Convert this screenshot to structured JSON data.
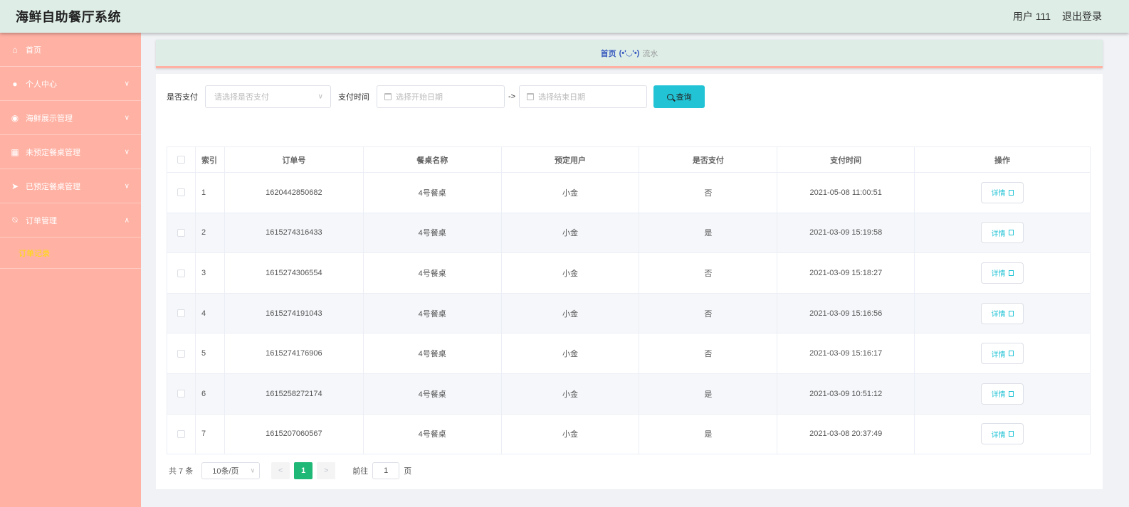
{
  "header": {
    "title": "海鲜自助餐厅系统",
    "user": "用户 111",
    "logout": "退出登录"
  },
  "sidebar": {
    "items": [
      {
        "label": "首页",
        "icon": "home-icon",
        "expandable": false
      },
      {
        "label": "个人中心",
        "icon": "user-icon",
        "expandable": true
      },
      {
        "label": "海鲜展示管理",
        "icon": "pin-icon",
        "expandable": true
      },
      {
        "label": "未预定餐桌管理",
        "icon": "grid-icon",
        "expandable": true
      },
      {
        "label": "已预定餐桌管理",
        "icon": "send-icon",
        "expandable": true
      },
      {
        "label": "订单管理",
        "icon": "bell-off-icon",
        "expandable": true
      }
    ],
    "sub_active": "订单记录"
  },
  "breadcrumb": {
    "home": "首页",
    "face": "(•'◡'•)",
    "current": "流水"
  },
  "filter": {
    "paid_label": "是否支付",
    "paid_placeholder": "请选择是否支付",
    "time_label": "支付时间",
    "start_placeholder": "选择开始日期",
    "separator": "->",
    "end_placeholder": "选择结束日期",
    "query_button": "查询"
  },
  "table": {
    "headers": {
      "index": "索引",
      "order_no": "订单号",
      "table_name": "餐桌名称",
      "user": "预定用户",
      "paid": "是否支付",
      "time": "支付时间",
      "action": "操作"
    },
    "detail_label": "详情",
    "rows": [
      {
        "index": "1",
        "order_no": "1620442850682",
        "table_name": "4号餐桌",
        "user": "小金",
        "paid": "否",
        "time": "2021-05-08 11:00:51"
      },
      {
        "index": "2",
        "order_no": "1615274316433",
        "table_name": "4号餐桌",
        "user": "小金",
        "paid": "是",
        "time": "2021-03-09 15:19:58"
      },
      {
        "index": "3",
        "order_no": "1615274306554",
        "table_name": "4号餐桌",
        "user": "小金",
        "paid": "否",
        "time": "2021-03-09 15:18:27"
      },
      {
        "index": "4",
        "order_no": "1615274191043",
        "table_name": "4号餐桌",
        "user": "小金",
        "paid": "否",
        "time": "2021-03-09 15:16:56"
      },
      {
        "index": "5",
        "order_no": "1615274176906",
        "table_name": "4号餐桌",
        "user": "小金",
        "paid": "否",
        "time": "2021-03-09 15:16:17"
      },
      {
        "index": "6",
        "order_no": "1615258272174",
        "table_name": "4号餐桌",
        "user": "小金",
        "paid": "是",
        "time": "2021-03-09 10:51:12"
      },
      {
        "index": "7",
        "order_no": "1615207060567",
        "table_name": "4号餐桌",
        "user": "小金",
        "paid": "是",
        "time": "2021-03-08 20:37:49"
      }
    ]
  },
  "pagination": {
    "total": "共 7 条",
    "page_size": "10条/页",
    "prev": "<",
    "current_page": "1",
    "next": ">",
    "goto_label": "前往",
    "goto_value": "1",
    "page_unit": "页"
  },
  "colors": {
    "sidebar": "#ffb1a3",
    "header": "#deeee7",
    "accent": "#22c3d5",
    "page_active": "#1fb877",
    "submenu_active": "#ffe000"
  }
}
